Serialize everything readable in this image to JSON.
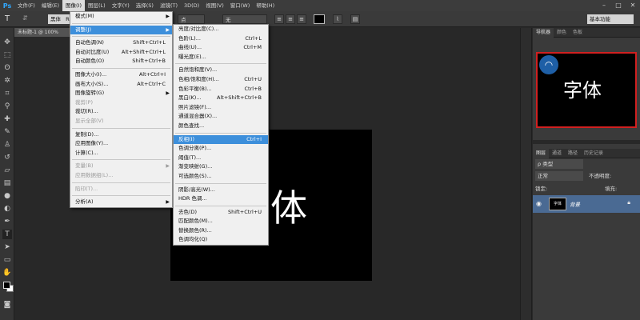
{
  "app": {
    "logo": "Ps"
  },
  "menubar": {
    "items": [
      "文件(F)",
      "编辑(E)",
      "图像(I)",
      "图层(L)",
      "文字(Y)",
      "选择(S)",
      "滤镜(T)",
      "3D(D)",
      "视图(V)",
      "窗口(W)",
      "帮助(H)"
    ],
    "window_controls": [
      "–",
      "□",
      "✕"
    ]
  },
  "optbar": {
    "tool_glyph": "T",
    "orient_glyph": "⇵",
    "font_family": "黑体",
    "font_style_partial": "R",
    "font_size": "点",
    "antialias": "无",
    "align_icons": [
      "≡",
      "≡",
      "≡"
    ],
    "color": "#000000",
    "warp_icon": "⌇",
    "panel_icon": "▤",
    "workspace": "基本功能"
  },
  "document": {
    "tab": "未标题-1 @ 100%"
  },
  "canvas": {
    "text": "体",
    "background": "#000000",
    "text_color": "#ffffff"
  },
  "image_menu": {
    "items": [
      {
        "label": "模式(M)",
        "shortcut": "",
        "submenu": true,
        "state": "normal"
      },
      {
        "sep": true
      },
      {
        "label": "调整(J)",
        "shortcut": "",
        "submenu": true,
        "state": "highlight"
      },
      {
        "sep": true
      },
      {
        "label": "自动色调(N)",
        "shortcut": "Shift+Ctrl+L",
        "state": "normal"
      },
      {
        "label": "自动对比度(U)",
        "shortcut": "Alt+Shift+Ctrl+L",
        "state": "normal"
      },
      {
        "label": "自动颜色(O)",
        "shortcut": "Shift+Ctrl+B",
        "state": "normal"
      },
      {
        "sep": true
      },
      {
        "label": "图像大小(I)...",
        "shortcut": "Alt+Ctrl+I",
        "state": "normal"
      },
      {
        "label": "画布大小(S)...",
        "shortcut": "Alt+Ctrl+C",
        "state": "normal"
      },
      {
        "label": "图像旋转(G)",
        "shortcut": "",
        "submenu": true,
        "state": "normal"
      },
      {
        "label": "裁剪(P)",
        "shortcut": "",
        "state": "disabled"
      },
      {
        "label": "裁切(R)...",
        "shortcut": "",
        "state": "normal"
      },
      {
        "label": "显示全部(V)",
        "shortcut": "",
        "state": "disabled"
      },
      {
        "sep": true
      },
      {
        "label": "复制(D)...",
        "shortcut": "",
        "state": "normal"
      },
      {
        "label": "应用图像(Y)...",
        "shortcut": "",
        "state": "normal"
      },
      {
        "label": "计算(C)...",
        "shortcut": "",
        "state": "normal"
      },
      {
        "sep": true
      },
      {
        "label": "变量(B)",
        "shortcut": "",
        "submenu": true,
        "state": "disabled"
      },
      {
        "label": "应用数据组(L)...",
        "shortcut": "",
        "state": "disabled"
      },
      {
        "sep": true
      },
      {
        "label": "陷印(T)...",
        "shortcut": "",
        "state": "disabled"
      },
      {
        "sep": true
      },
      {
        "label": "分析(A)",
        "shortcut": "",
        "submenu": true,
        "state": "normal"
      }
    ]
  },
  "adjust_menu": {
    "items": [
      {
        "label": "亮度/对比度(C)...",
        "shortcut": "",
        "state": "normal"
      },
      {
        "label": "色阶(L)...",
        "shortcut": "Ctrl+L",
        "state": "normal"
      },
      {
        "label": "曲线(U)...",
        "shortcut": "Ctrl+M",
        "state": "normal"
      },
      {
        "label": "曝光度(E)...",
        "shortcut": "",
        "state": "normal"
      },
      {
        "sep": true
      },
      {
        "label": "自然饱和度(V)...",
        "shortcut": "",
        "state": "normal"
      },
      {
        "label": "色相/饱和度(H)...",
        "shortcut": "Ctrl+U",
        "state": "normal"
      },
      {
        "label": "色彩平衡(B)...",
        "shortcut": "Ctrl+B",
        "state": "normal"
      },
      {
        "label": "黑白(K)...",
        "shortcut": "Alt+Shift+Ctrl+B",
        "state": "normal"
      },
      {
        "label": "照片滤镜(F)...",
        "shortcut": "",
        "state": "normal"
      },
      {
        "label": "通道混合器(X)...",
        "shortcut": "",
        "state": "normal"
      },
      {
        "label": "颜色查找...",
        "shortcut": "",
        "state": "normal"
      },
      {
        "sep": true
      },
      {
        "label": "反相(I)",
        "shortcut": "Ctrl+I",
        "state": "highlight"
      },
      {
        "label": "色调分离(P)...",
        "shortcut": "",
        "state": "normal"
      },
      {
        "label": "阈值(T)...",
        "shortcut": "",
        "state": "normal"
      },
      {
        "label": "渐变映射(G)...",
        "shortcut": "",
        "state": "normal"
      },
      {
        "label": "可选颜色(S)...",
        "shortcut": "",
        "state": "normal"
      },
      {
        "sep": true
      },
      {
        "label": "阴影/高光(W)...",
        "shortcut": "",
        "state": "normal"
      },
      {
        "label": "HDR 色调...",
        "shortcut": "",
        "state": "normal"
      },
      {
        "sep": true
      },
      {
        "label": "去色(D)",
        "shortcut": "Shift+Ctrl+U",
        "state": "normal"
      },
      {
        "label": "匹配颜色(M)...",
        "shortcut": "",
        "state": "normal"
      },
      {
        "label": "替换颜色(R)...",
        "shortcut": "",
        "state": "normal"
      },
      {
        "label": "色调均化(Q)",
        "shortcut": "",
        "state": "normal"
      }
    ]
  },
  "navigator": {
    "tabs": [
      "导航器",
      "颜色",
      "色板"
    ],
    "preview_text": "字体",
    "badge_icon": "wifi-icon"
  },
  "layers": {
    "tabs": [
      "图层",
      "通道",
      "路径",
      "历史记录"
    ],
    "filter_label": "ρ 类型",
    "blend_mode": "正常",
    "opacity_label": "不透明度:",
    "lock_label": "锁定:",
    "fill_label": "填充:",
    "layer_name": "背景",
    "thumb_text": "字体"
  }
}
